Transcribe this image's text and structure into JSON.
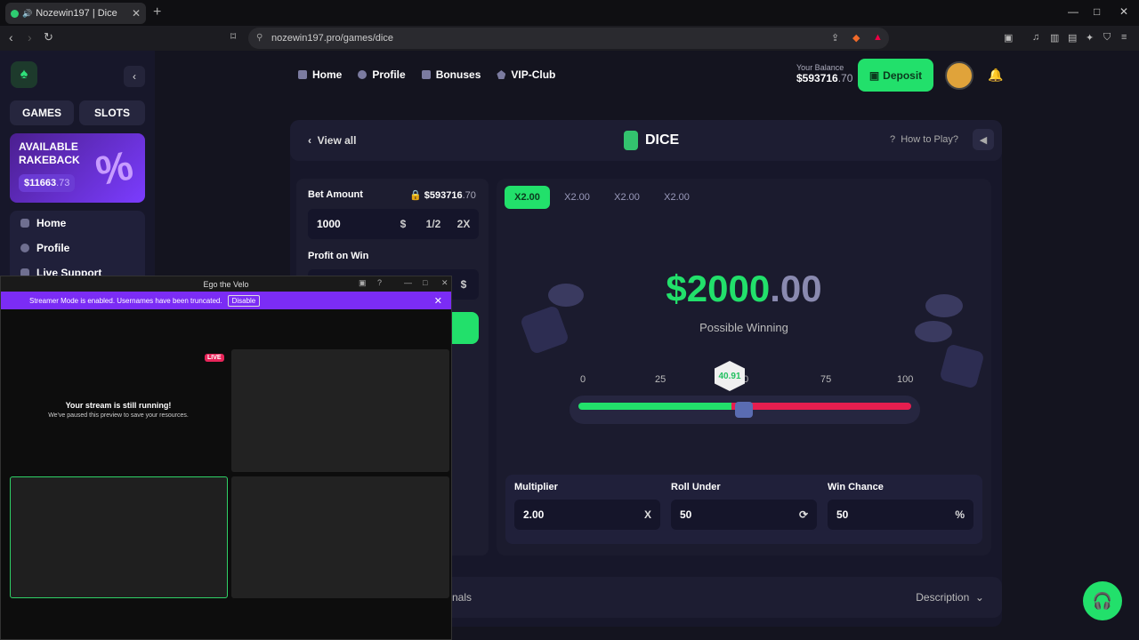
{
  "browser": {
    "tab_title": "Nozewin197 | Dice",
    "url": "nozewin197.pro/games/dice"
  },
  "sidebar": {
    "tabs": [
      "GAMES",
      "SLOTS"
    ],
    "rakeback": {
      "title_line1": "AVAILABLE",
      "title_line2": "RAKEBACK",
      "amount_main": "$11663",
      "amount_dec": ".73",
      "badge": "%"
    },
    "items": [
      {
        "label": "Home"
      },
      {
        "label": "Profile"
      },
      {
        "label": "Live Support"
      }
    ]
  },
  "topnav": {
    "items": [
      {
        "label": "Home"
      },
      {
        "label": "Profile"
      },
      {
        "label": "Bonuses"
      },
      {
        "label": "VIP-Club"
      }
    ],
    "balance_label": "Your Balance",
    "balance_main": "$593716",
    "balance_dec": ".70",
    "deposit_label": "Deposit"
  },
  "game_header": {
    "view_all": "View all",
    "title": "DICE",
    "how_to": "How to Play?"
  },
  "bet": {
    "bet_amount_label": "Bet Amount",
    "balance_main": "$593716",
    "balance_dec": ".70",
    "amount": "1000",
    "currency": "$",
    "half": "1/2",
    "double": "2X",
    "profit_label": "Profit on Win",
    "profit_currency": "$"
  },
  "multiplier_tabs": [
    "X2.00",
    "X2.00",
    "X2.00",
    "X2.00"
  ],
  "winning": {
    "main": "$2000",
    "dec": ".00",
    "label": "Possible Winning"
  },
  "slider": {
    "ticks": [
      "0",
      "25",
      "50",
      "75",
      "100"
    ],
    "roll_result": "40.91",
    "value": 46
  },
  "fields": [
    {
      "label": "Multiplier",
      "value": "2.00",
      "suffix": "X"
    },
    {
      "label": "Roll Under",
      "value": "50",
      "suffix": "⟳"
    },
    {
      "label": "Win Chance",
      "value": "50",
      "suffix": "%"
    }
  ],
  "description_label": "Description",
  "section_left_label": "nals",
  "overlay": {
    "title": "Ego the Velo",
    "banner": "Streamer Mode is enabled. Usernames have been truncated.",
    "disable": "Disable",
    "live": "LIVE",
    "running_title": "Your stream is still running!",
    "running_sub": "We've paused this preview to save your resources."
  }
}
